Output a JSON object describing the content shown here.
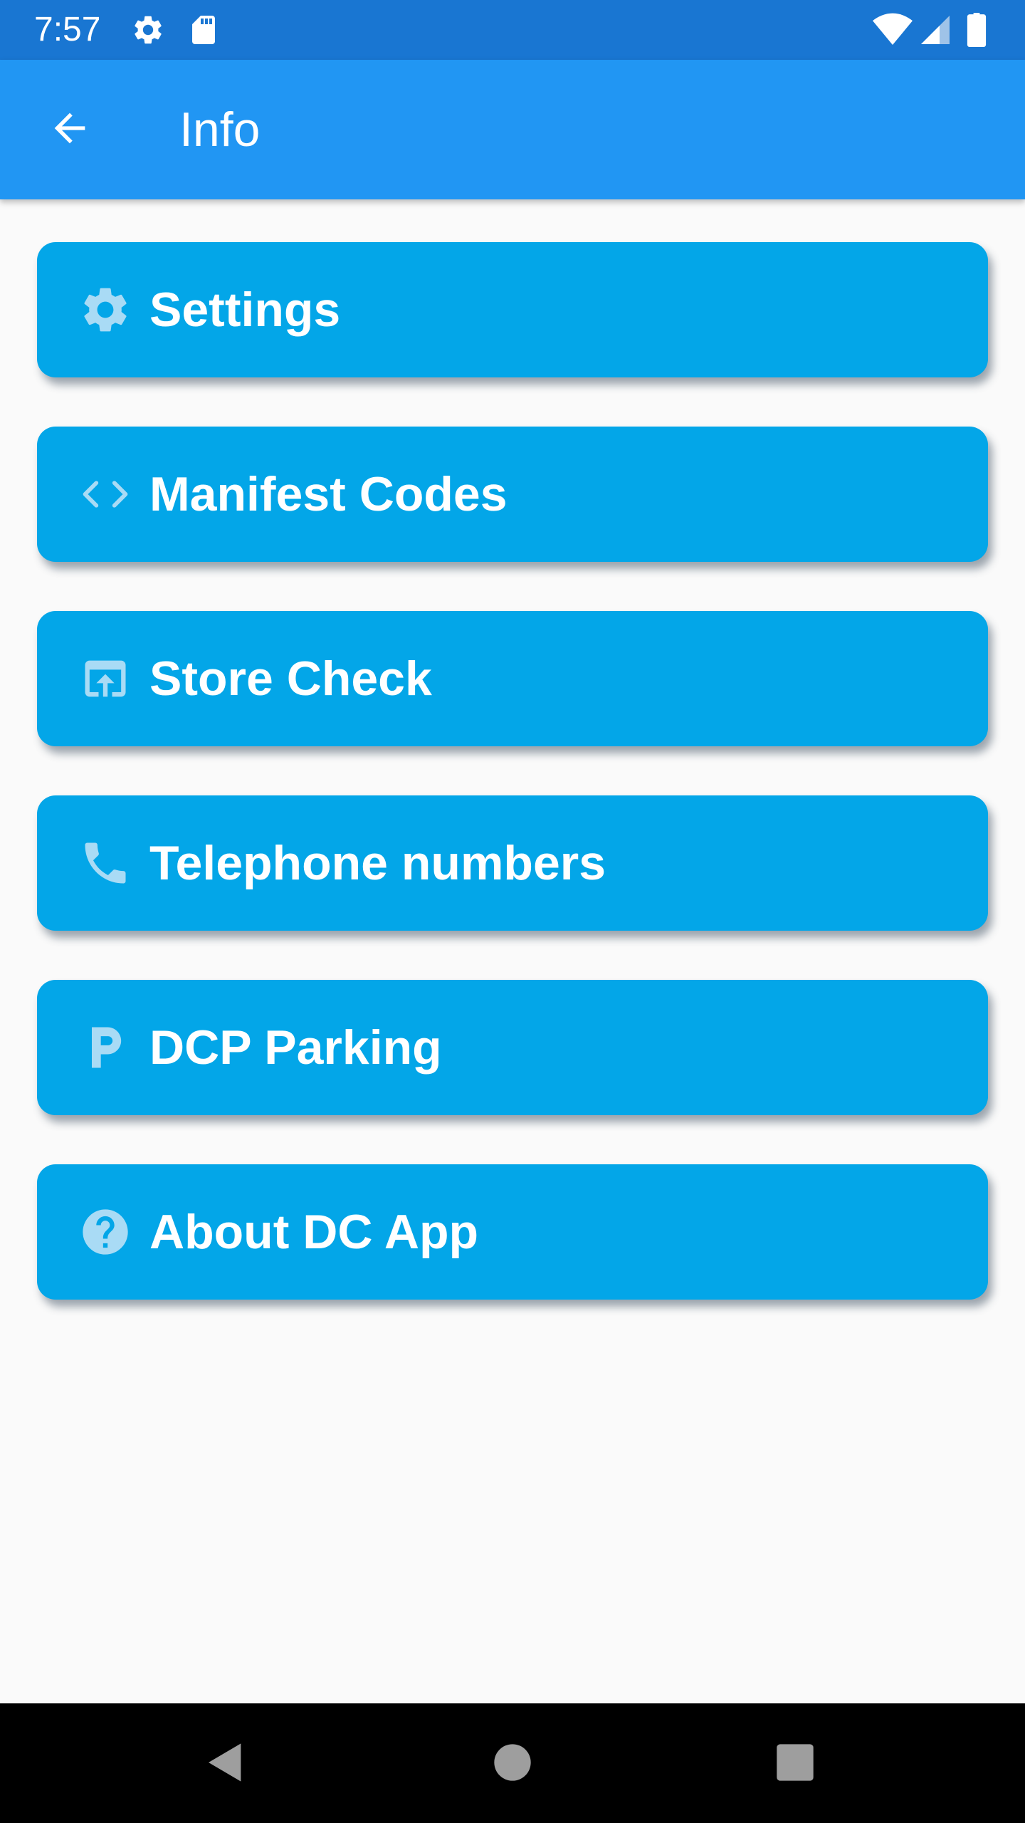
{
  "status_bar": {
    "time": "7:57",
    "icons": [
      "gear-icon",
      "sd-card-icon",
      "wifi-icon",
      "signal-icon",
      "battery-icon"
    ]
  },
  "app_bar": {
    "title": "Info",
    "back_icon": "arrow-back-icon"
  },
  "menu": {
    "items": [
      {
        "label": "Settings",
        "icon": "gear-icon"
      },
      {
        "label": "Manifest Codes",
        "icon": "code-icon"
      },
      {
        "label": "Store Check",
        "icon": "open-in-browser-icon"
      },
      {
        "label": "Telephone numbers",
        "icon": "phone-icon"
      },
      {
        "label": "DCP Parking",
        "icon": "parking-icon"
      },
      {
        "label": "About DC App",
        "icon": "help-circle-icon"
      }
    ]
  },
  "nav_bar": {
    "buttons": [
      "back-triangle-icon",
      "home-circle-icon",
      "recents-square-icon"
    ]
  },
  "colors": {
    "status_bar": "#1976d2",
    "app_bar": "#2196f3",
    "button": "#03a6e8",
    "icon_tint": "#a9dbf5",
    "background": "#fafafa"
  }
}
